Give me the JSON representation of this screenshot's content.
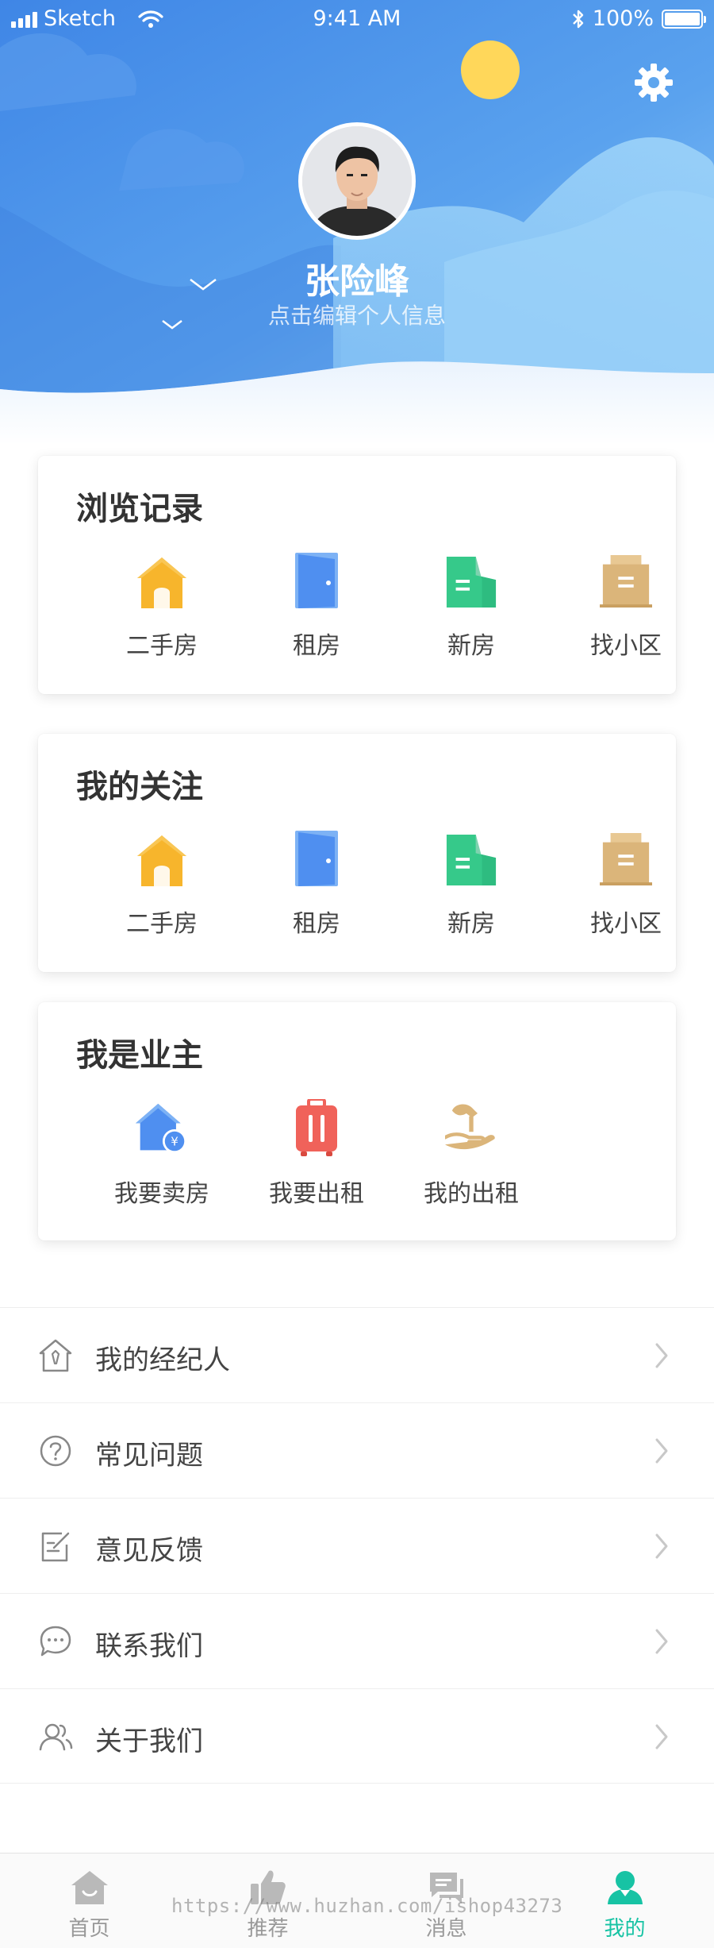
{
  "status_bar": {
    "carrier": "Sketch",
    "time": "9:41 AM",
    "battery": "100%"
  },
  "profile": {
    "name": "张险峰",
    "subtitle": "点击编辑个人信息"
  },
  "browse_history": {
    "title": "浏览记录",
    "items": [
      {
        "label": "二手房",
        "icon": "house-icon"
      },
      {
        "label": "租房",
        "icon": "door-icon"
      },
      {
        "label": "新房",
        "icon": "new-building-icon"
      },
      {
        "label": "找小区",
        "icon": "community-building-icon"
      }
    ]
  },
  "my_follows": {
    "title": "我的关注",
    "items": [
      {
        "label": "二手房",
        "icon": "house-icon"
      },
      {
        "label": "租房",
        "icon": "door-icon"
      },
      {
        "label": "新房",
        "icon": "new-building-icon"
      },
      {
        "label": "找小区",
        "icon": "community-building-icon"
      }
    ]
  },
  "owner": {
    "title": "我是业主",
    "items": [
      {
        "label": "我要卖房",
        "icon": "sell-house-icon"
      },
      {
        "label": "我要出租",
        "icon": "suitcase-icon"
      },
      {
        "label": "我的出租",
        "icon": "hand-key-icon"
      }
    ]
  },
  "menu": [
    {
      "label": "我的经纪人",
      "icon": "agent-icon"
    },
    {
      "label": "常见问题",
      "icon": "question-icon"
    },
    {
      "label": "意见反馈",
      "icon": "feedback-icon"
    },
    {
      "label": "联系我们",
      "icon": "chat-icon"
    },
    {
      "label": "关于我们",
      "icon": "people-icon"
    }
  ],
  "tabs": [
    {
      "label": "首页",
      "icon": "home-icon",
      "active": false
    },
    {
      "label": "推荐",
      "icon": "thumbs-up-icon",
      "active": false
    },
    {
      "label": "消息",
      "icon": "message-icon",
      "active": false
    },
    {
      "label": "我的",
      "icon": "user-icon",
      "active": true
    }
  ],
  "watermark": "https://www.huzhan.com/ishop43273",
  "colors": {
    "accent": "#17c3a4",
    "header_blue": "#4a90e2",
    "sun": "#ffd75a",
    "house_orange": "#f7b52c",
    "door_blue": "#4f8ff0",
    "new_green": "#36c98a",
    "community_tan": "#dbb57a",
    "suitcase_red": "#f0625a"
  }
}
